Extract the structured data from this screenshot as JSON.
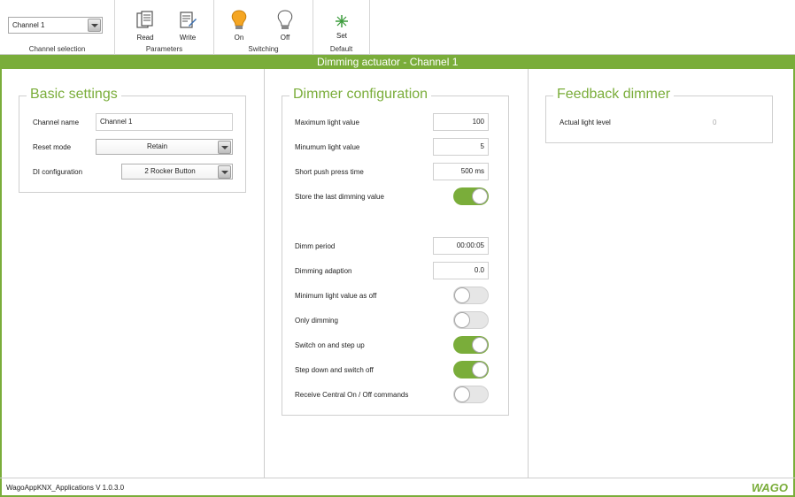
{
  "toolbar": {
    "channel_select_value": "Channel 1",
    "channel_group_label": "Channel selection",
    "read_label": "Read",
    "write_label": "Write",
    "parameters_group_label": "Parameters",
    "on_label": "On",
    "off_label": "Off",
    "switching_group_label": "Switching",
    "set_label": "Set",
    "default_label": "Default"
  },
  "title": "Dimming actuator - Channel 1",
  "basic": {
    "legend": "Basic settings",
    "channel_name_label": "Channel name",
    "channel_name_value": "Channel 1",
    "reset_mode_label": "Reset mode",
    "reset_mode_value": "Retain",
    "di_config_label": "DI configuration",
    "di_config_value": "2 Rocker Button"
  },
  "dimmer": {
    "legend": "Dimmer configuration",
    "max_light_label": "Maximum light value",
    "max_light_value": "100",
    "min_light_label": "Minumum light value",
    "min_light_value": "5",
    "short_push_label": "Short push press time",
    "short_push_value": "500 ms",
    "store_last_label": "Store the last dimming value",
    "store_last_on": true,
    "dimm_period_label": "Dimm period",
    "dimm_period_value": "00:00:05",
    "dimming_adaption_label": "Dimming adaption",
    "dimming_adaption_value": "0.0",
    "min_as_off_label": "Minimum light value as off",
    "min_as_off_on": false,
    "only_dimming_label": "Only dimming",
    "only_dimming_on": false,
    "switch_on_step_up_label": "Switch on and step up",
    "switch_on_step_up_on": true,
    "step_down_switch_off_label": "Step down and switch off",
    "step_down_switch_off_on": true,
    "receive_central_label": "Receive Central On / Off commands",
    "receive_central_on": false
  },
  "feedback": {
    "legend": "Feedback dimmer",
    "actual_level_label": "Actual light level",
    "actual_level_value": "0"
  },
  "status": {
    "version": "WagoAppKNX_Applications V 1.0.3.0",
    "logo": "WAGO"
  },
  "colors": {
    "accent": "#7aad3a",
    "border": "#cfcfcf"
  }
}
